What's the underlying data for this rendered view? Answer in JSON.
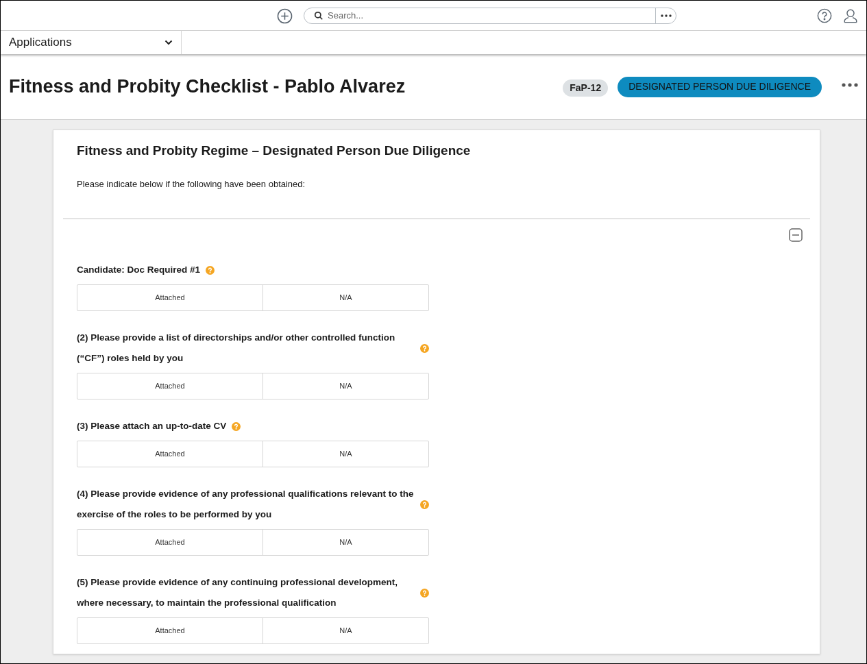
{
  "topbar": {
    "search": {
      "placeholder": "Search..."
    }
  },
  "nav": {
    "applications": "Applications"
  },
  "header": {
    "title": "Fitness and Probity Checklist - Pablo Alvarez",
    "badge": "FaP-12",
    "stage": "DESIGNATED PERSON DUE DILIGENCE"
  },
  "form": {
    "heading": "Fitness and Probity Regime – Designated Person Due Diligence",
    "intro": "Please indicate below if the following have been obtained:",
    "questions": [
      {
        "label": "Candidate: Doc Required #1",
        "options": [
          "Attached",
          "N/A"
        ]
      },
      {
        "label": "(2) Please provide a list of directorships and/or other controlled function (“CF”) roles held by you",
        "options": [
          "Attached",
          "N/A"
        ]
      },
      {
        "label": "(3) Please attach an up-to-date CV",
        "options": [
          "Attached",
          "N/A"
        ]
      },
      {
        "label": "(4) Please provide evidence of any professional qualifications relevant to the exercise of the roles to be performed by you",
        "options": [
          "Attached",
          "N/A"
        ]
      },
      {
        "label": "(5) Please provide evidence of any continuing professional development, where necessary, to maintain the professional qualification",
        "options": [
          "Attached",
          "N/A"
        ]
      }
    ]
  }
}
